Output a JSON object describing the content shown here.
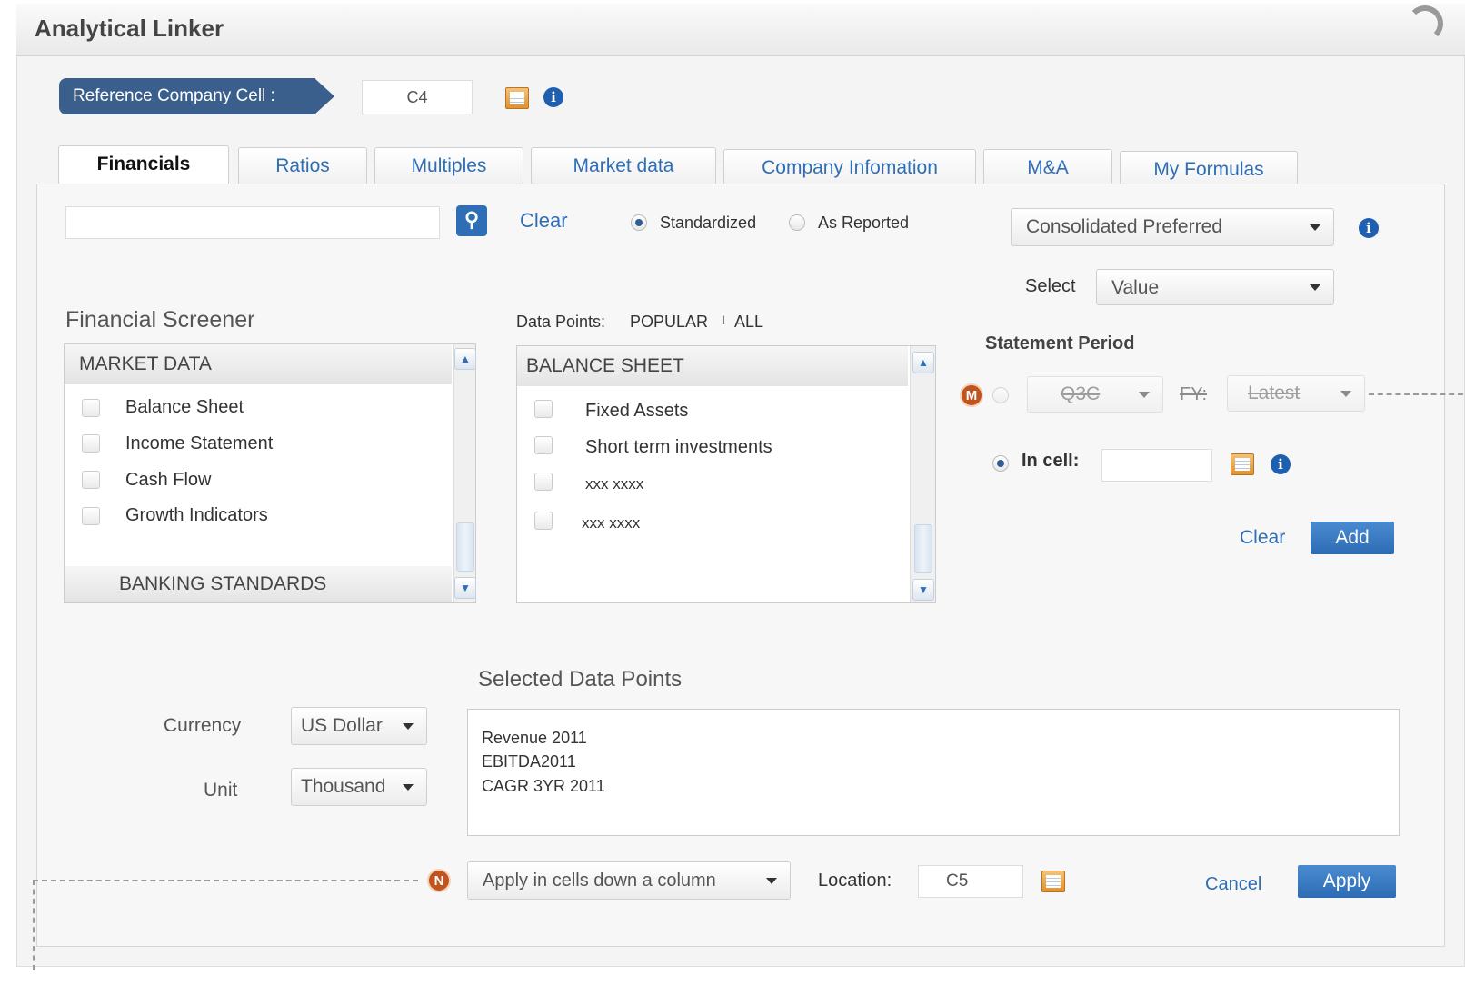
{
  "window": {
    "title": "Analytical Linker"
  },
  "reference": {
    "label": "Reference Company Cell :",
    "value": "C4"
  },
  "tabs": [
    {
      "label": "Financials",
      "active": true
    },
    {
      "label": "Ratios"
    },
    {
      "label": "Multiples"
    },
    {
      "label": "Market data"
    },
    {
      "label": "Company Infomation"
    },
    {
      "label": "M&A"
    },
    {
      "label": "My Formulas"
    }
  ],
  "toolbar": {
    "search_value": "",
    "search_icon": "magnifier-icon",
    "clear_label": "Clear",
    "standardized_label": "Standardized",
    "as_reported_label": "As Reported",
    "selected_mode": "Standardized",
    "consolidation": "Consolidated Preferred"
  },
  "select": {
    "label": "Select",
    "value": "Value"
  },
  "screener": {
    "title": "Financial Screener",
    "header": "MARKET DATA",
    "items": [
      "Balance Sheet",
      "Income Statement",
      "Cash Flow",
      "Growth Indicators"
    ],
    "footer": "BANKING STANDARDS"
  },
  "datapoints": {
    "label": "Data Points:",
    "popular": "POPULAR",
    "separator": "I",
    "all": "ALL",
    "header": "BALANCE SHEET",
    "items": [
      "Fixed Assets",
      "Short term investments",
      "xxx xxxx",
      "xxx xxxx"
    ]
  },
  "period": {
    "title": "Statement Period",
    "quarter": "Q3C",
    "fy_label": "FY:",
    "fy_value": "Latest",
    "in_cell_label": "In cell:",
    "in_cell_value": "",
    "clear_label": "Clear",
    "add_label": "Add"
  },
  "selected": {
    "title": "Selected Data Points",
    "lines": [
      "Revenue 2011",
      "EBITDA2011",
      "CAGR 3YR 2011"
    ]
  },
  "currency": {
    "label": "Currency",
    "value": "US Dollar"
  },
  "unit": {
    "label": "Unit",
    "value": "Thousand"
  },
  "footer": {
    "apply_mode": "Apply in cells down a column",
    "location_label": "Location:",
    "location_value": "C5",
    "cancel_label": "Cancel",
    "apply_label": "Apply"
  },
  "markers": {
    "m": "M",
    "n": "N"
  },
  "colors": {
    "accent": "#2f6eb5",
    "badge": "#3b5f8c",
    "marker": "#c0541f"
  }
}
